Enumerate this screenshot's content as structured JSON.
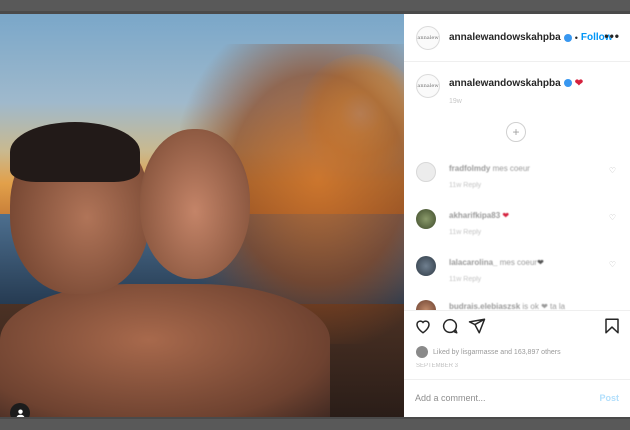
{
  "post": {
    "username": "annalewandowskahpba",
    "follow_label": "Follow",
    "more_label": "•••",
    "separator": "•",
    "avatar_text": "annalew"
  },
  "caption": {
    "username": "annalewandowskahpba",
    "emoji": "❤",
    "meta": "19w"
  },
  "comments": [
    {
      "user": "fradfolmdy",
      "text": "mes coeur",
      "meta": "11w   Reply",
      "emoji": ""
    },
    {
      "user": "akharifkipa83",
      "text": "",
      "meta": "11w   Reply",
      "emoji": "❤"
    },
    {
      "user": "lalacarolina_",
      "text": "mes coeur",
      "meta": "11w   Reply",
      "emoji": "❤"
    },
    {
      "user": "budrais.elebiaszsk",
      "text": "is ok ❤ ta la",
      "meta": "",
      "emoji": ""
    }
  ],
  "likes_text": "Liked by lisgarmasse and 163,897 others",
  "post_date": "SEPTEMBER 3",
  "add_comment": {
    "placeholder": "Add a comment...",
    "post_label": "Post"
  },
  "icons": [
    "heart-icon",
    "comment-icon",
    "share-icon",
    "bookmark-icon",
    "user-tag-icon",
    "more-icon",
    "verified-icon",
    "load-more-icon"
  ],
  "colors": {
    "accent": "#0095f6",
    "verified": "#3897f0",
    "heart": "#d4213d",
    "post_disabled": "#b2dffc"
  }
}
